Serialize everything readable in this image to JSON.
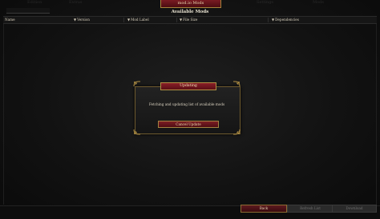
{
  "window": {
    "title": "mod.io Mods",
    "background_tabs": [
      "Edition",
      "Extras",
      "Settings",
      "Mods"
    ]
  },
  "header": {
    "title": "Available Mods",
    "search_placeholder": ""
  },
  "table": {
    "columns": [
      {
        "label": "Name",
        "sortable": false
      },
      {
        "label": "Version",
        "sortable": true
      },
      {
        "label": "Mod Label",
        "sortable": true
      },
      {
        "label": "File Size",
        "sortable": true
      },
      {
        "label": "Dependencies",
        "sortable": true
      }
    ],
    "sort_arrow": "▼"
  },
  "dialog": {
    "title": "Updating",
    "message": "Fetching and updating list of available mods",
    "cancel_label": "Cancel Update"
  },
  "footer": {
    "back_label": "Back",
    "refresh_label": "Refresh List",
    "download_label": "Download"
  },
  "colors": {
    "accent_red": "#7a1b22",
    "gold_border": "#a4823b",
    "background": "#121212"
  }
}
